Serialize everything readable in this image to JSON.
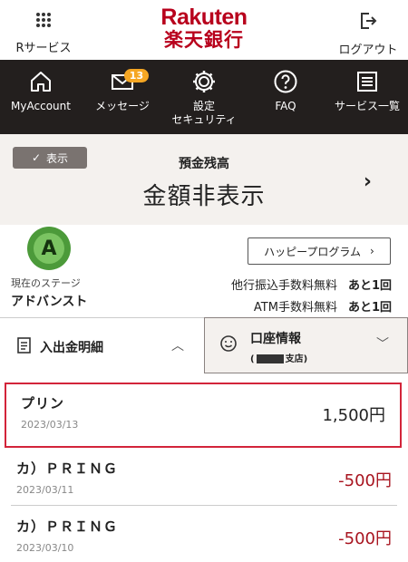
{
  "header": {
    "left_label": "Rサービス",
    "logo_en": "Rakuten",
    "logo_jp": "楽天銀行",
    "right_label": "ログアウト"
  },
  "nav": {
    "items": [
      {
        "label": "MyAccount",
        "icon": "home-icon"
      },
      {
        "label": "メッセージ",
        "icon": "mail-icon",
        "badge": "13"
      },
      {
        "label": "設定\nセキュリティ",
        "icon": "gear-icon"
      },
      {
        "label": "FAQ",
        "icon": "question-icon"
      },
      {
        "label": "サービス一覧",
        "icon": "list-icon"
      }
    ]
  },
  "balance": {
    "toggle_label": "表示",
    "title": "預金残高",
    "value": "金額非表示"
  },
  "stage": {
    "badge_letter": "A",
    "caption": "現在のステージ",
    "name": "アドバンスト",
    "happy_button": "ハッピープログラム",
    "fees": [
      {
        "title": "他行振込手数料無料",
        "count": "あと1回"
      },
      {
        "title": "ATM手数料無料",
        "count": "あと1回"
      }
    ]
  },
  "tabs": {
    "statement_label": "入出金明細",
    "account_label": "口座情報",
    "account_branch_prefix": "(",
    "account_branch_suffix": "支店)"
  },
  "transactions": [
    {
      "name": "プリン",
      "date": "2023/03/13",
      "amount": "1,500円",
      "negative": false
    },
    {
      "name": "カ）ＰＲＩＮＧ",
      "date": "2023/03/11",
      "amount": "-500円",
      "negative": true
    },
    {
      "name": "カ）ＰＲＩＮＧ",
      "date": "2023/03/10",
      "amount": "-500円",
      "negative": true
    }
  ],
  "colors": {
    "brand": "#b8001c",
    "nav_bg": "#231f1e",
    "badge": "#f5a623",
    "negative": "#a8141f",
    "highlight": "#d3243a"
  }
}
